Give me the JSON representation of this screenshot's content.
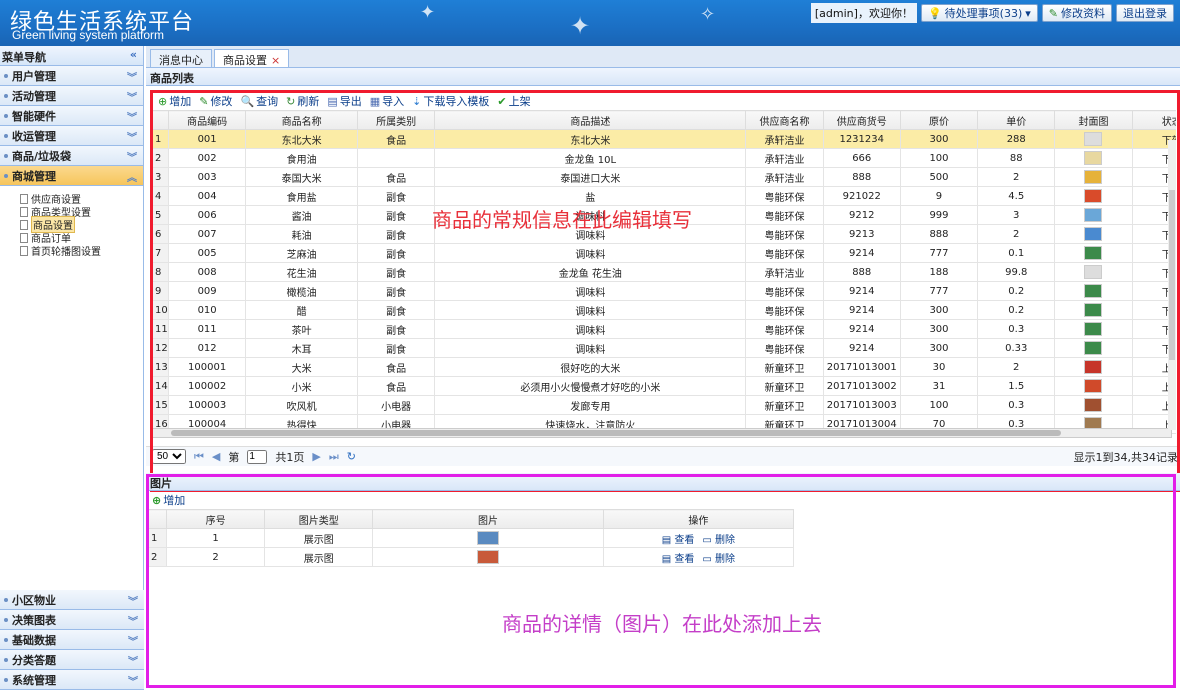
{
  "header": {
    "title": "绿色生活系统平台",
    "subtitle": "Green living system platform",
    "welcome": "[admin]，欢迎你！",
    "pending": "待处理事项(33)",
    "edit_profile": "修改资料",
    "logout": "退出登录"
  },
  "sidebar": {
    "title": "菜单导航",
    "menus_top": [
      "用户管理",
      "活动管理",
      "智能硬件",
      "收运管理",
      "商品/垃圾袋",
      "商城管理"
    ],
    "active_menu": "商城管理",
    "tree": [
      "供应商设置",
      "商品类型设置",
      "商品设置",
      "商品订单",
      "首页轮播图设置"
    ],
    "tree_selected": "商品设置",
    "menus_bottom": [
      "小区物业",
      "决策图表",
      "基础数据",
      "分类答题",
      "系统管理"
    ]
  },
  "tabs": [
    {
      "label": "消息中心"
    },
    {
      "label": "商品设置"
    }
  ],
  "goods": {
    "panel_title": "商品列表",
    "toolbar": [
      "增加",
      "修改",
      "查询",
      "刷新",
      "导出",
      "导入",
      "下载导入模板",
      "上架"
    ],
    "columns": [
      "商品编码",
      "商品名称",
      "所属类别",
      "商品描述",
      "供应商名称",
      "供应商货号",
      "原价",
      "单价",
      "封面图",
      "状态"
    ],
    "rows": [
      [
        "1",
        "001",
        "东北大米",
        "食品",
        "东北大米",
        "承轩洁业",
        "1231234",
        "300",
        "288",
        "",
        "下架"
      ],
      [
        "2",
        "002",
        "食用油",
        "",
        "金龙鱼 10L",
        "承轩洁业",
        "666",
        "100",
        "88",
        "",
        "下架"
      ],
      [
        "3",
        "003",
        "泰国大米",
        "食品",
        "泰国进口大米",
        "承轩洁业",
        "888",
        "500",
        "2",
        "",
        "下架"
      ],
      [
        "4",
        "004",
        "食用盐",
        "副食",
        "盐",
        "粤能环保",
        "921022",
        "9",
        "4.5",
        "",
        "下架"
      ],
      [
        "5",
        "006",
        "酱油",
        "副食",
        "调味料",
        "粤能环保",
        "9212",
        "999",
        "3",
        "",
        "下架"
      ],
      [
        "6",
        "007",
        "耗油",
        "副食",
        "调味料",
        "粤能环保",
        "9213",
        "888",
        "2",
        "",
        "下架"
      ],
      [
        "7",
        "005",
        "芝麻油",
        "副食",
        "调味料",
        "粤能环保",
        "9214",
        "777",
        "0.1",
        "",
        "下架"
      ],
      [
        "8",
        "008",
        "花生油",
        "副食",
        "金龙鱼 花生油",
        "承轩洁业",
        "888",
        "188",
        "99.8",
        "",
        "下架"
      ],
      [
        "9",
        "009",
        "橄榄油",
        "副食",
        "调味料",
        "粤能环保",
        "9214",
        "777",
        "0.2",
        "",
        "下架"
      ],
      [
        "10",
        "010",
        "醋",
        "副食",
        "调味料",
        "粤能环保",
        "9214",
        "300",
        "0.2",
        "",
        "下架"
      ],
      [
        "11",
        "011",
        "茶叶",
        "副食",
        "调味料",
        "粤能环保",
        "9214",
        "300",
        "0.3",
        "",
        "下架"
      ],
      [
        "12",
        "012",
        "木耳",
        "副食",
        "调味料",
        "粤能环保",
        "9214",
        "300",
        "0.33",
        "",
        "下架"
      ],
      [
        "13",
        "100001",
        "大米",
        "食品",
        "很好吃的大米",
        "新童环卫",
        "20171013001",
        "30",
        "2",
        "",
        "上架"
      ],
      [
        "14",
        "100002",
        "小米",
        "食品",
        "必须用小火慢慢煮才好吃的小米",
        "新童环卫",
        "20171013002",
        "31",
        "1.5",
        "",
        "上架"
      ],
      [
        "15",
        "100003",
        "吹风机",
        "小电器",
        "发廊专用",
        "新童环卫",
        "20171013003",
        "100",
        "0.3",
        "",
        "上架"
      ],
      [
        "16",
        "100004",
        "热得快",
        "小电器",
        "快速烧水，注意防火",
        "新童环卫",
        "20171013004",
        "70",
        "0.3",
        "",
        "上架"
      ]
    ],
    "pager": {
      "size": "50",
      "page_prefix": "第",
      "page": "1",
      "page_suffix": "共1页",
      "info": "显示1到34,共34记录"
    },
    "overlay_note": "商品的常规信息在此编辑填写"
  },
  "images": {
    "panel_title": "图片",
    "add": "增加",
    "columns": [
      "序号",
      "图片类型",
      "图片",
      "操作"
    ],
    "rows": [
      [
        "1",
        "1",
        "展示图"
      ],
      [
        "2",
        "2",
        "展示图"
      ]
    ],
    "view": "查看",
    "delete": "删除",
    "overlay_note": "商品的详情（图片）在此处添加上去"
  },
  "colors": {
    "highlight_row": "#fbeca6",
    "red_frame": "#f01b2e",
    "magenta_frame": "#e21ee8"
  }
}
